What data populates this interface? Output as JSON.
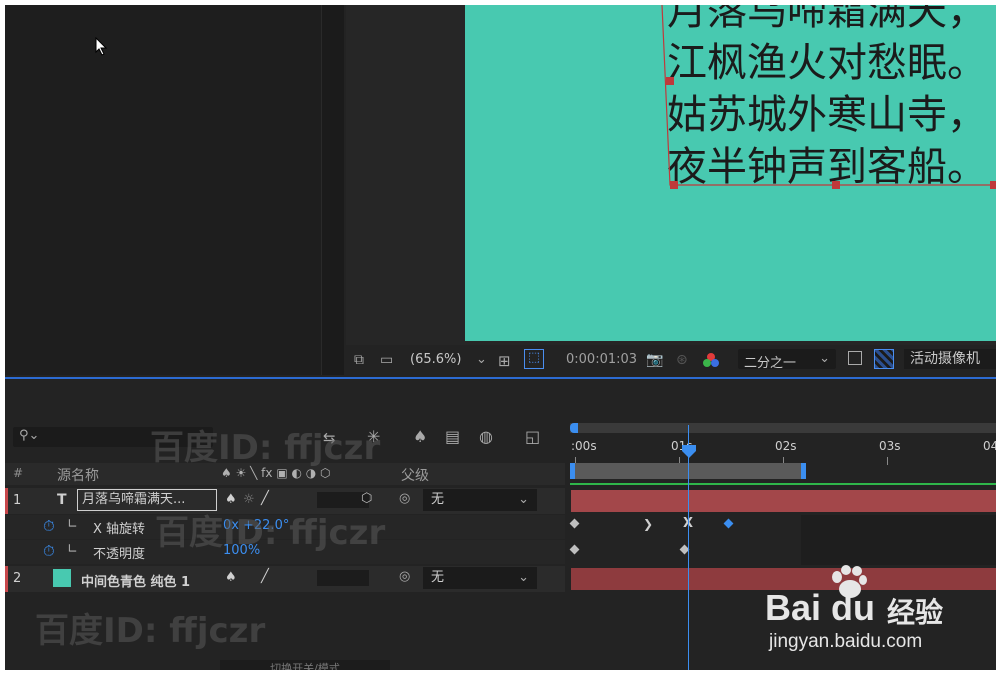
{
  "composition": {
    "poem_lines": [
      "月落乌啼霜满天，",
      "江枫渔火对愁眠。",
      "姑苏城外寒山寺，",
      "夜半钟声到客船。"
    ]
  },
  "viewer_bar": {
    "zoom": "(65.6%)",
    "timecode": "0:00:01:03",
    "resolution": "二分之一",
    "camera": "活动摄像机"
  },
  "timeline": {
    "search_placeholder": "",
    "ruler_labels": [
      ":00s",
      "01s",
      "02s",
      "03s",
      "04s"
    ],
    "columns": {
      "index": "#",
      "source_name": "源名称",
      "switches": "♠ ☀ ╲ fx ▣ ◐ ◑ ⬡",
      "parent": "父级"
    },
    "layers": [
      {
        "index": "1",
        "type_icon": "T",
        "name": "月落乌啼霜满天...",
        "parent": "无",
        "color": "#c7474b"
      },
      {
        "index": "2",
        "type_icon": "",
        "name": "中间色青色 纯色 1",
        "parent": "无",
        "color": "#c7474b",
        "swatch": "#48c9b0"
      }
    ],
    "properties": [
      {
        "name": "X 轴旋转",
        "value_a": "0x",
        "value_b": "+22.0°"
      },
      {
        "name": "不透明度",
        "value": "100%"
      }
    ],
    "bottom_label": "切换开关/模式"
  },
  "watermarks": [
    "百度ID: ffjczr",
    "百度ID: ffjczr",
    "百度ID: ffjczr"
  ],
  "baidu": {
    "brand": "Bai",
    "brand2": "du",
    "jingyan": "经验",
    "url": "jingyan.baidu.com"
  }
}
